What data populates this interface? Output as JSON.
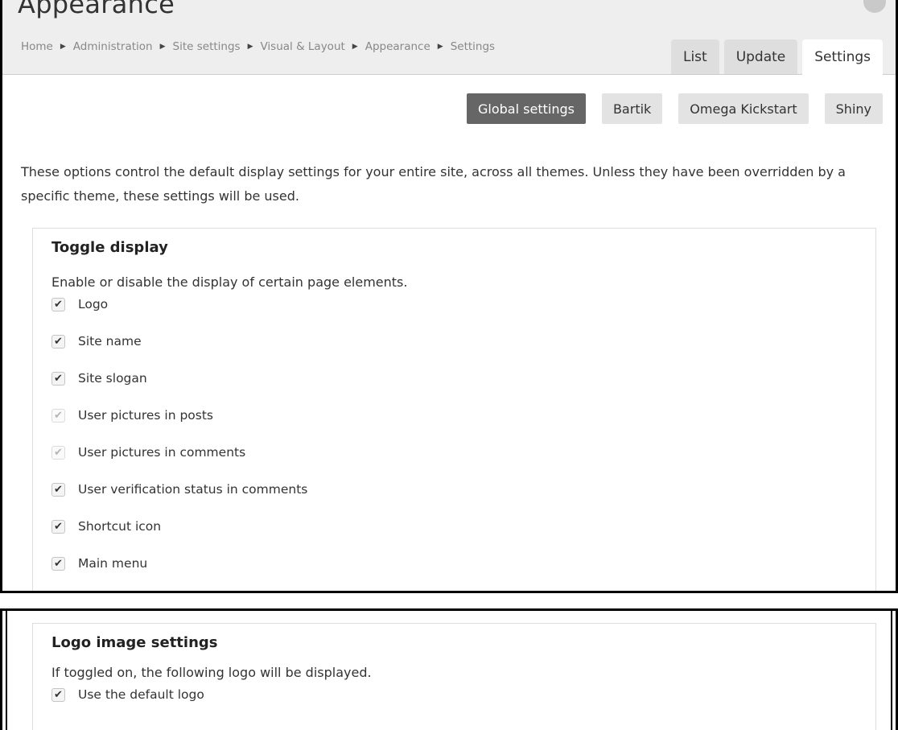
{
  "header": {
    "title": "Appearance",
    "breadcrumb": [
      "Home",
      "Administration",
      "Site settings",
      "Visual & Layout",
      "Appearance",
      "Settings"
    ],
    "separator_glyph": "▶",
    "tabs": [
      {
        "label": "List",
        "active": false
      },
      {
        "label": "Update",
        "active": false
      },
      {
        "label": "Settings",
        "active": true
      }
    ]
  },
  "theme_tabs": [
    {
      "label": "Global settings",
      "active": true
    },
    {
      "label": "Bartik",
      "active": false
    },
    {
      "label": "Omega Kickstart",
      "active": false
    },
    {
      "label": "Shiny",
      "active": false
    }
  ],
  "description": "These options control the default display settings for your entire site, across all themes. Unless they have been overridden by a specific theme, these settings will be used.",
  "toggle_display": {
    "legend": "Toggle display",
    "description": "Enable or disable the display of certain page elements.",
    "options": [
      {
        "label": "Logo",
        "checked": true,
        "disabled": false
      },
      {
        "label": "Site name",
        "checked": true,
        "disabled": false
      },
      {
        "label": "Site slogan",
        "checked": true,
        "disabled": false
      },
      {
        "label": "User pictures in posts",
        "checked": true,
        "disabled": true
      },
      {
        "label": "User pictures in comments",
        "checked": true,
        "disabled": true
      },
      {
        "label": "User verification status in comments",
        "checked": true,
        "disabled": false
      },
      {
        "label": "Shortcut icon",
        "checked": true,
        "disabled": false
      },
      {
        "label": "Main menu",
        "checked": true,
        "disabled": false
      }
    ]
  },
  "logo_settings": {
    "legend": "Logo image settings",
    "description": "If toggled on, the following logo will be displayed.",
    "options": [
      {
        "label": "Use the default logo",
        "checked": true,
        "disabled": false
      }
    ]
  },
  "icons": {
    "check": "check-icon",
    "breadcrumb_separator": "triangle-right-icon"
  },
  "colors": {
    "active_theme_tab": "#666666",
    "header_band": "#eeeeee",
    "tab_inactive": "#dedede"
  }
}
